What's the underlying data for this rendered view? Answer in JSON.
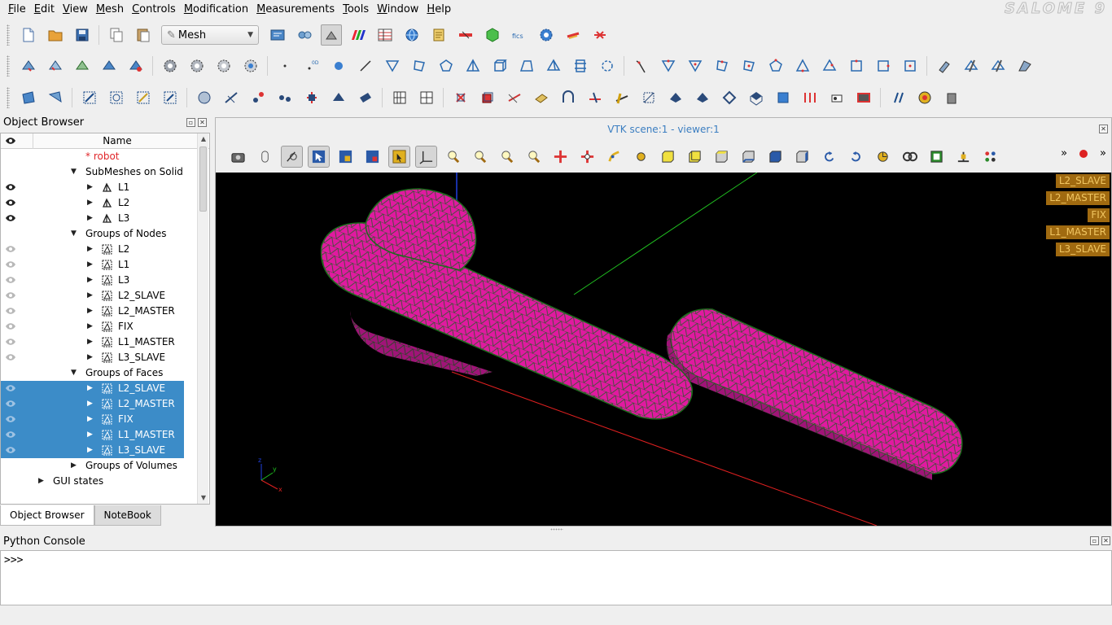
{
  "app": {
    "brand": "SALOME 9"
  },
  "menu": [
    {
      "label": "File"
    },
    {
      "label": "Edit"
    },
    {
      "label": "View"
    },
    {
      "label": "Mesh"
    },
    {
      "label": "Controls"
    },
    {
      "label": "Modification"
    },
    {
      "label": "Measurements"
    },
    {
      "label": "Tools"
    },
    {
      "label": "Window"
    },
    {
      "label": "Help"
    }
  ],
  "toolbar": {
    "module_selected": "Mesh"
  },
  "object_browser": {
    "title": "Object Browser",
    "column_name": "Name",
    "rows": [
      {
        "label": "* robot",
        "level": 0,
        "arrow": "",
        "icon": "",
        "eye": "",
        "selected": false,
        "red": true
      },
      {
        "label": "SubMeshes on Solid",
        "level": 1,
        "arrow": "down",
        "icon": "",
        "eye": "",
        "selected": false
      },
      {
        "label": "L1",
        "level": 2,
        "arrow": "right",
        "icon": "submesh",
        "eye": "dark",
        "selected": false
      },
      {
        "label": "L2",
        "level": 2,
        "arrow": "right",
        "icon": "submesh",
        "eye": "dark",
        "selected": false
      },
      {
        "label": "L3",
        "level": 2,
        "arrow": "right",
        "icon": "submesh",
        "eye": "dark",
        "selected": false
      },
      {
        "label": "Groups of Nodes",
        "level": 1,
        "arrow": "down",
        "icon": "",
        "eye": "",
        "selected": false
      },
      {
        "label": "L2",
        "level": 2,
        "arrow": "right",
        "icon": "group",
        "eye": "light",
        "selected": false
      },
      {
        "label": "L1",
        "level": 2,
        "arrow": "right",
        "icon": "group",
        "eye": "light",
        "selected": false
      },
      {
        "label": "L3",
        "level": 2,
        "arrow": "right",
        "icon": "group",
        "eye": "light",
        "selected": false
      },
      {
        "label": "L2_SLAVE",
        "level": 2,
        "arrow": "right",
        "icon": "group",
        "eye": "light",
        "selected": false
      },
      {
        "label": "L2_MASTER",
        "level": 2,
        "arrow": "right",
        "icon": "group",
        "eye": "light",
        "selected": false
      },
      {
        "label": "FIX",
        "level": 2,
        "arrow": "right",
        "icon": "group",
        "eye": "light",
        "selected": false
      },
      {
        "label": "L1_MASTER",
        "level": 2,
        "arrow": "right",
        "icon": "group",
        "eye": "light",
        "selected": false
      },
      {
        "label": "L3_SLAVE",
        "level": 2,
        "arrow": "right",
        "icon": "group",
        "eye": "light",
        "selected": false
      },
      {
        "label": "Groups of Faces",
        "level": 1,
        "arrow": "down",
        "icon": "",
        "eye": "",
        "selected": false
      },
      {
        "label": "L2_SLAVE",
        "level": 2,
        "arrow": "right",
        "icon": "group",
        "eye": "light",
        "selected": true
      },
      {
        "label": "L2_MASTER",
        "level": 2,
        "arrow": "right",
        "icon": "group",
        "eye": "light",
        "selected": true
      },
      {
        "label": "FIX",
        "level": 2,
        "arrow": "right",
        "icon": "group",
        "eye": "light",
        "selected": true
      },
      {
        "label": "L1_MASTER",
        "level": 2,
        "arrow": "right",
        "icon": "group",
        "eye": "light",
        "selected": true
      },
      {
        "label": "L3_SLAVE",
        "level": 2,
        "arrow": "right",
        "icon": "group",
        "eye": "light",
        "selected": true
      },
      {
        "label": "Groups of Volumes",
        "level": 1,
        "arrow": "right",
        "icon": "",
        "eye": "",
        "selected": false
      },
      {
        "label": "GUI states",
        "level": -1,
        "arrow": "right",
        "icon": "",
        "eye": "",
        "selected": false
      }
    ]
  },
  "tabs": [
    {
      "label": "Object Browser",
      "active": true
    },
    {
      "label": "NoteBook",
      "active": false
    }
  ],
  "viewer": {
    "title": "VTK scene:1 - viewer:1",
    "more_label": "»",
    "legend": [
      "L2_SLAVE",
      "L2_MASTER",
      "FIX",
      "L1_MASTER",
      "L3_SLAVE"
    ]
  },
  "python_console": {
    "title": "Python Console",
    "prompt": ">>>"
  },
  "colors": {
    "mesh_fill": "#e01aa0",
    "mesh_edge": "#1c6b1c",
    "selection": "#3c8cc8",
    "legend_bg": "#a06a10",
    "legend_text": "#f0c560",
    "viewer_title": "#3b7ec1"
  }
}
